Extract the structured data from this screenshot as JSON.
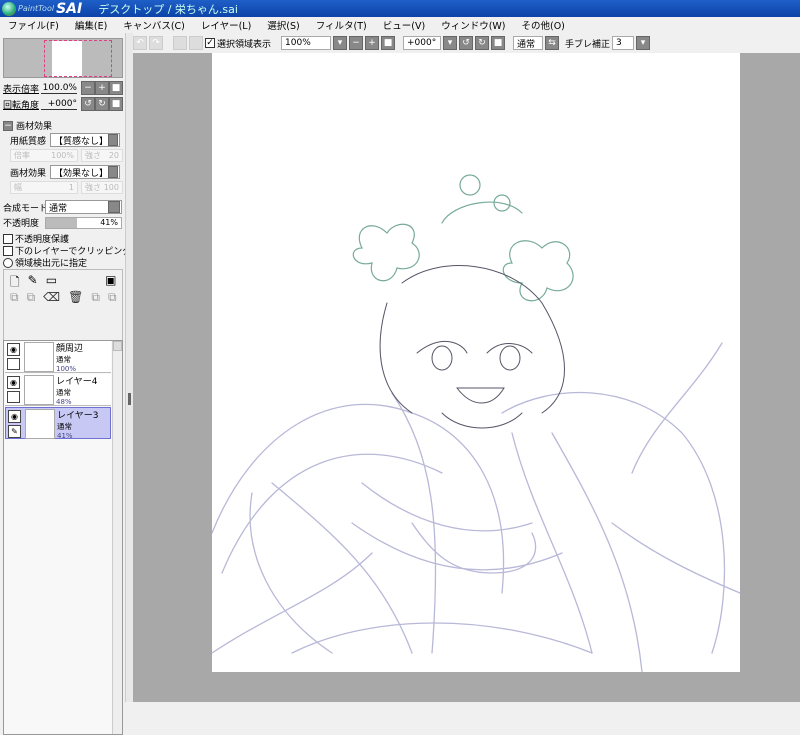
{
  "titlebar": {
    "logo_small": "PaintTool",
    "logo_big": "SAI",
    "title": "デスクトップ / 栄ちゃん.sai"
  },
  "menu": [
    "ファイル(F)",
    "編集(E)",
    "キャンバス(C)",
    "レイヤー(L)",
    "選択(S)",
    "フィルタ(T)",
    "ビュー(V)",
    "ウィンドウ(W)",
    "その他(O)"
  ],
  "toolbar": {
    "selection_label": "選択領域表示",
    "selection_checked": true,
    "zoom": "100%",
    "rotation": "+000°",
    "blend": "通常",
    "stabilizer_label": "手ブレ補正",
    "stabilizer": "3"
  },
  "navigator": {
    "zoom_label": "表示倍率",
    "zoom_value": "100.0%",
    "rotate_label": "回転角度",
    "rotate_value": "+000°"
  },
  "texture": {
    "section": "画材効果",
    "paper_label": "用紙質感",
    "paper_value": "【質感なし】",
    "scale_label": "倍率",
    "scale_value": "100%",
    "strength_label": "強さ",
    "strength_value": "20",
    "effect_label": "画材効果",
    "effect_value": "【効果なし】",
    "width_label": "幅",
    "width_value": "1",
    "strength2_value": "100"
  },
  "layer_props": {
    "blend_label": "合成モード",
    "blend_value": "通常",
    "opacity_label": "不透明度",
    "opacity_value": "41%",
    "opacity_fraction": 0.41,
    "preserve": "不透明度保護",
    "clip": "下のレイヤーでクリッピング",
    "selsrc": "領域検出元に指定"
  },
  "layers": [
    {
      "name": "顔周辺",
      "mode": "通常",
      "opacity": "100%"
    },
    {
      "name": "レイヤー4",
      "mode": "通常",
      "opacity": "48%"
    },
    {
      "name": "レイヤー3",
      "mode": "通常",
      "opacity": "41%",
      "active": true
    }
  ],
  "colors": {
    "titlebar": "#0c43a8",
    "canvas_bg": "#a8a8a8",
    "active_layer": "#c8c8f4",
    "sketch": "#b8b8d8",
    "lineart": "#555566",
    "accent_green": "#5a9a70"
  }
}
